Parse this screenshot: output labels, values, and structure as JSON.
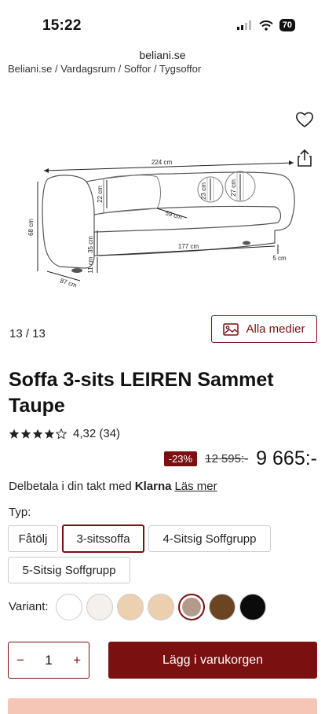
{
  "status_bar": {
    "time": "15:22",
    "battery": "70"
  },
  "browser": {
    "url": "beliani.se"
  },
  "breadcrumb": "Beliani.se / Vardagsrum / Soffor / Tygsoffor",
  "gallery": {
    "counter": "13 / 13",
    "media_button": "Alla medier",
    "dimensions": {
      "width_total": "224 cm",
      "height_total": "68 cm",
      "depth": "87 cm",
      "back_height": "22 cm",
      "pillow_small": "23 cm",
      "pillow_large": "27 cm",
      "seat_depth": "59 cm",
      "seat_height": "35 cm",
      "seat_width": "177 cm",
      "leg_height": "11 cm",
      "leg_small": "5 cm"
    }
  },
  "product": {
    "title": "Soffa 3-sits LEIREN Sammet Taupe",
    "rating": "4,32 (34)",
    "discount": "-23%",
    "old_price": "12 595:-",
    "price": "9 665:-"
  },
  "klarna": {
    "text": "Delbetala i din takt med",
    "logo": "Klarna",
    "link": "Läs mer"
  },
  "type_selector": {
    "label": "Typ:",
    "options": [
      "Fåtölj",
      "3-sitssoffa",
      "4-Sitsig Soffgrupp",
      "5-Sitsig Soffgrupp"
    ],
    "selected": "3-sitssoffa"
  },
  "variants": {
    "label": "Variant:",
    "colors": [
      "#ffffff",
      "#f4f1ec",
      "#ecd0b0",
      "#eccfaf",
      "#b49a8a",
      "#6b4422",
      "#0b0b0b"
    ],
    "selected_index": 4
  },
  "quantity": {
    "minus": "−",
    "value": "1",
    "plus": "+"
  },
  "cart_button": "Lägg i varukorgen"
}
